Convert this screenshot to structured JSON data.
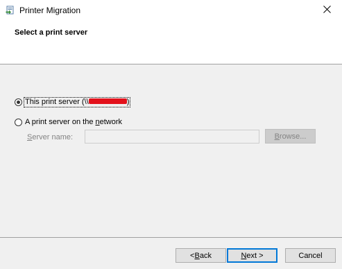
{
  "window": {
    "title": "Printer Migration",
    "icon": "printer-migration-icon",
    "close_icon": "close-icon"
  },
  "header": {
    "heading": "Select a print server"
  },
  "options": {
    "this_server": {
      "label_prefix": "This print server (\\\\",
      "label_suffix": ")",
      "selected": true,
      "redaction_color": "#e3111b"
    },
    "network_server": {
      "label_before": "A print server on the ",
      "label_accel": "n",
      "label_after": "etwork",
      "selected": false
    }
  },
  "server_field": {
    "label_accel": "S",
    "label_rest": "erver name:",
    "value": "",
    "disabled": true
  },
  "browse_button": {
    "label_accel": "B",
    "label_rest": "rowse...",
    "disabled": true
  },
  "footer": {
    "back": {
      "prefix": "< ",
      "accel": "B",
      "rest": "ack"
    },
    "next": {
      "accel": "N",
      "rest": "ext >"
    },
    "cancel": {
      "label": "Cancel"
    }
  },
  "colors": {
    "accent": "#0078d7",
    "window_bg": "#f0f0f0",
    "disabled_text": "#838383"
  }
}
